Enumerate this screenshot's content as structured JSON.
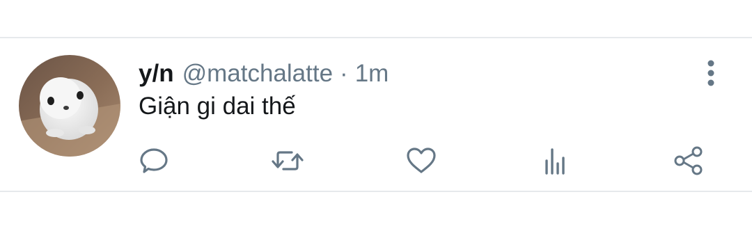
{
  "tweet": {
    "display_name": "y/n",
    "handle": "@matchalatte",
    "separator": "·",
    "time": "1m",
    "text": "Giận gi dai thế",
    "avatar_icon": "seal-plush-photo"
  },
  "actions": [
    {
      "icon": "reply-icon"
    },
    {
      "icon": "retweet-icon"
    },
    {
      "icon": "like-icon"
    },
    {
      "icon": "stats-icon"
    },
    {
      "icon": "share-icon"
    }
  ],
  "menu": {
    "icon": "more-vertical-icon"
  },
  "colors": {
    "text": "#14171a",
    "secondary": "#657786",
    "icon": "#657786",
    "divider": "#e6e9ec"
  }
}
